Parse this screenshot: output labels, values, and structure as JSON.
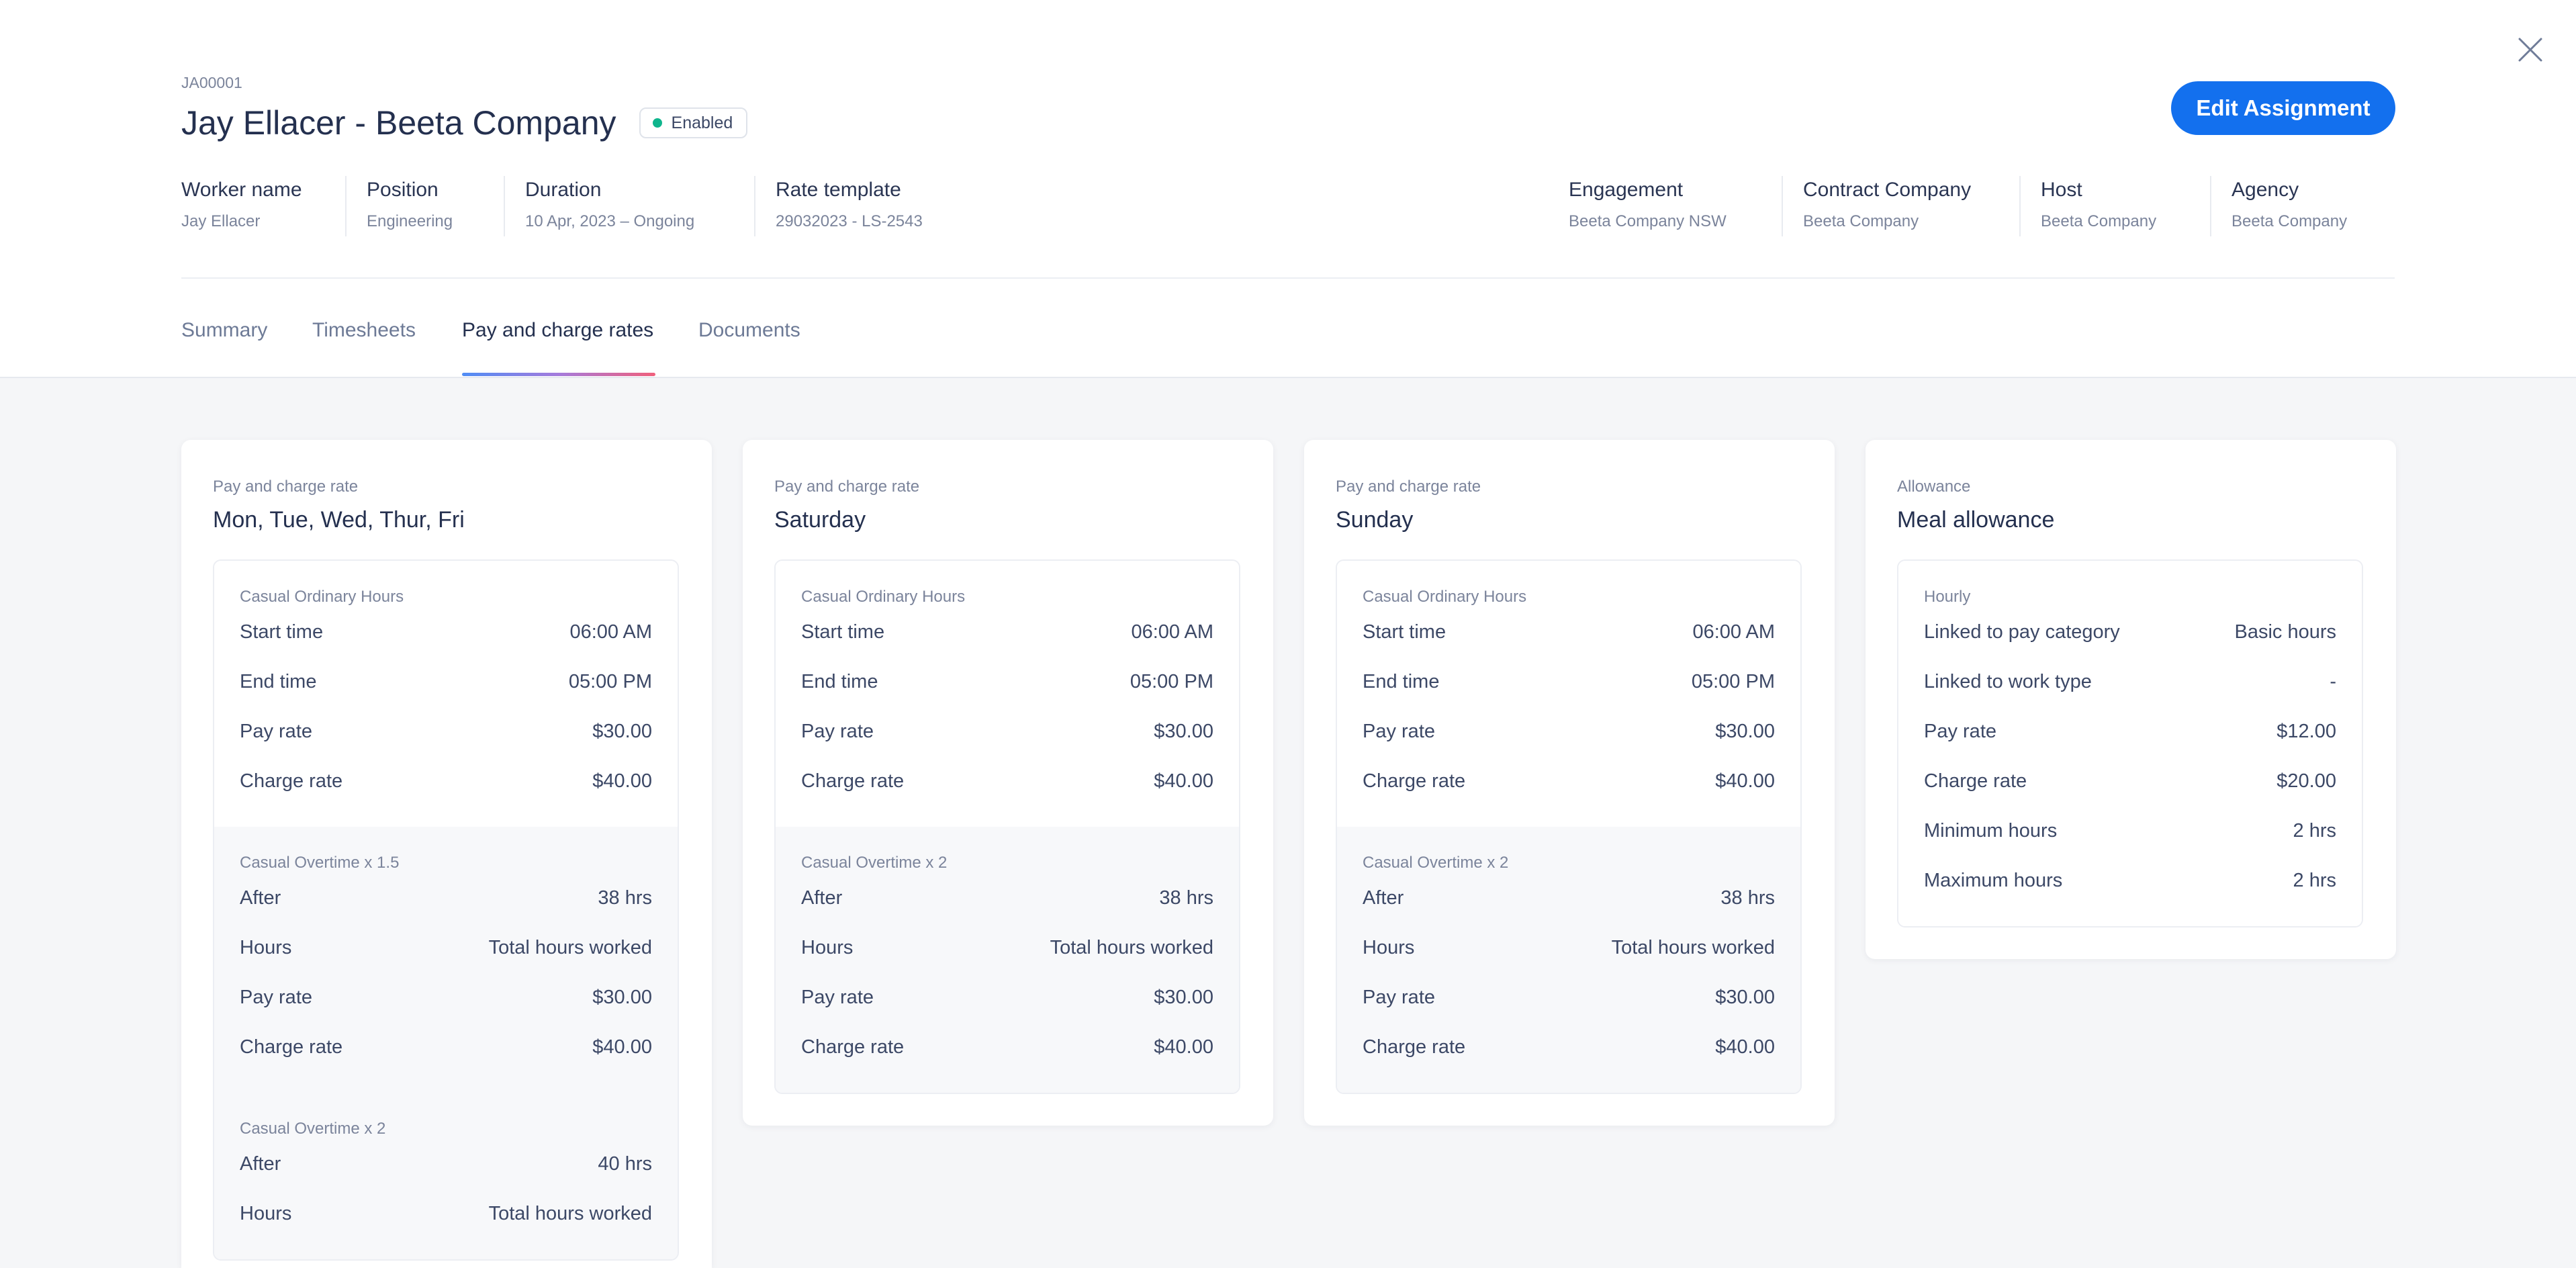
{
  "assignment": {
    "id": "JA00001",
    "title": "Jay Ellacer - Beeta Company",
    "status": "Enabled",
    "edit_label": "Edit Assignment"
  },
  "details_left": [
    {
      "label": "Worker name",
      "value": "Jay Ellacer"
    },
    {
      "label": "Position",
      "value": "Engineering"
    },
    {
      "label": "Duration",
      "value": "10 Apr, 2023 – Ongoing"
    },
    {
      "label": "Rate template",
      "value": "29032023 - LS-2543"
    }
  ],
  "details_right": [
    {
      "label": "Engagement",
      "value": "Beeta Company NSW"
    },
    {
      "label": "Contract Company",
      "value": "Beeta Company"
    },
    {
      "label": "Host",
      "value": "Beeta Company"
    },
    {
      "label": "Agency",
      "value": "Beeta Company"
    }
  ],
  "tabs": [
    {
      "label": "Summary",
      "active": false
    },
    {
      "label": "Timesheets",
      "active": false
    },
    {
      "label": "Pay and charge rates",
      "active": true
    },
    {
      "label": "Documents",
      "active": false
    }
  ],
  "cards": [
    {
      "kicker": "Pay and charge rate",
      "title": "Mon, Tue, Wed, Thur, Fri",
      "sections": [
        {
          "label": "Casual Ordinary Hours",
          "rows": [
            {
              "label": "Start time",
              "value": "06:00 AM"
            },
            {
              "label": "End time",
              "value": "05:00 PM"
            },
            {
              "label": "Pay rate",
              "value": "$30.00"
            },
            {
              "label": "Charge rate",
              "value": "$40.00"
            }
          ]
        },
        {
          "label": "Casual Overtime x 1.5",
          "rows": [
            {
              "label": "After",
              "value": "38 hrs"
            },
            {
              "label": "Hours",
              "value": "Total hours worked"
            },
            {
              "label": "Pay rate",
              "value": "$30.00"
            },
            {
              "label": "Charge rate",
              "value": "$40.00"
            }
          ]
        },
        {
          "label": "Casual Overtime x 2",
          "rows": [
            {
              "label": "After",
              "value": "40 hrs"
            },
            {
              "label": "Hours",
              "value": "Total hours worked"
            }
          ]
        }
      ]
    },
    {
      "kicker": "Pay and charge rate",
      "title": "Saturday",
      "sections": [
        {
          "label": "Casual Ordinary Hours",
          "rows": [
            {
              "label": "Start time",
              "value": "06:00 AM"
            },
            {
              "label": "End time",
              "value": "05:00 PM"
            },
            {
              "label": "Pay rate",
              "value": "$30.00"
            },
            {
              "label": "Charge rate",
              "value": "$40.00"
            }
          ]
        },
        {
          "label": "Casual Overtime x 2",
          "rows": [
            {
              "label": "After",
              "value": "38 hrs"
            },
            {
              "label": "Hours",
              "value": "Total hours worked"
            },
            {
              "label": "Pay rate",
              "value": "$30.00"
            },
            {
              "label": "Charge rate",
              "value": "$40.00"
            }
          ]
        }
      ]
    },
    {
      "kicker": "Pay and charge rate",
      "title": "Sunday",
      "sections": [
        {
          "label": "Casual Ordinary Hours",
          "rows": [
            {
              "label": "Start time",
              "value": "06:00 AM"
            },
            {
              "label": "End time",
              "value": "05:00 PM"
            },
            {
              "label": "Pay rate",
              "value": "$30.00"
            },
            {
              "label": "Charge rate",
              "value": "$40.00"
            }
          ]
        },
        {
          "label": "Casual Overtime x 2",
          "rows": [
            {
              "label": "After",
              "value": "38 hrs"
            },
            {
              "label": "Hours",
              "value": "Total hours worked"
            },
            {
              "label": "Pay rate",
              "value": "$30.00"
            },
            {
              "label": "Charge rate",
              "value": "$40.00"
            }
          ]
        }
      ]
    },
    {
      "kicker": "Allowance",
      "title": "Meal allowance",
      "sections": [
        {
          "label": "Hourly",
          "rows": [
            {
              "label": "Linked to pay category",
              "value": "Basic hours"
            },
            {
              "label": "Linked to work type",
              "value": "-"
            },
            {
              "label": "Pay rate",
              "value": "$12.00"
            },
            {
              "label": "Charge rate",
              "value": "$20.00"
            },
            {
              "label": "Minimum hours",
              "value": "2 hrs"
            },
            {
              "label": "Maximum hours",
              "value": "2 hrs"
            }
          ]
        }
      ]
    }
  ],
  "icons": {
    "close": "close-icon"
  },
  "colors": {
    "primary": "#1370ee",
    "status_enabled": "#0fb58d"
  }
}
